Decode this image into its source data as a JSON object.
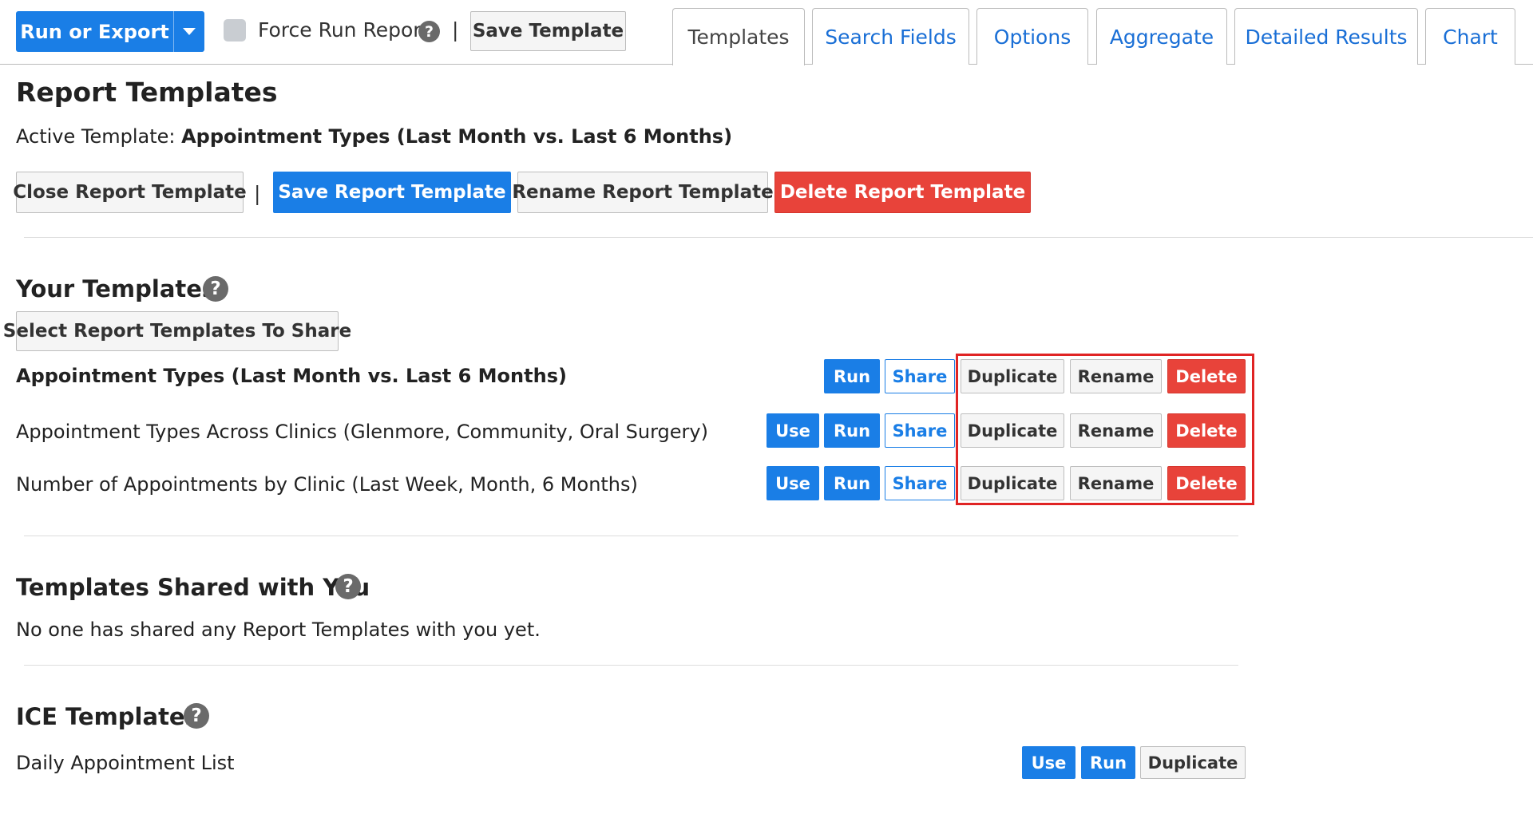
{
  "toolbar": {
    "run_or_export": "Run or Export",
    "force_run_label": "Force Run Report",
    "separator": "|",
    "save_template": "Save Template"
  },
  "tabs": [
    {
      "label": "Templates",
      "active": true
    },
    {
      "label": "Search Fields"
    },
    {
      "label": "Options"
    },
    {
      "label": "Aggregate"
    },
    {
      "label": "Detailed Results"
    },
    {
      "label": "Chart"
    }
  ],
  "page": {
    "title": "Report Templates",
    "active_prefix": "Active Template: ",
    "active_name": "Appointment Types (Last Month vs. Last 6 Months)"
  },
  "active_actions": {
    "close": "Close Report Template",
    "separator": "|",
    "save": "Save Report Template",
    "rename": "Rename Report Template",
    "delete": "Delete Report Template"
  },
  "your_templates": {
    "heading": "Your Templates",
    "share_select": "Select Report Templates To Share",
    "rows": [
      {
        "name": "Appointment Types (Last Month vs. Last 6 Months)"
      },
      {
        "name": "Appointment Types Across Clinics (Glenmore, Community, Oral Surgery)"
      },
      {
        "name": "Number of Appointments by Clinic (Last Week, Month, 6 Months)"
      }
    ],
    "labels": {
      "use": "Use",
      "run": "Run",
      "share": "Share",
      "duplicate": "Duplicate",
      "rename": "Rename",
      "delete": "Delete"
    }
  },
  "shared": {
    "heading": "Templates Shared with You",
    "empty": "No one has shared any Report Templates with you yet."
  },
  "ice": {
    "heading": "ICE Templates",
    "rows": [
      {
        "name": "Daily Appointment List"
      }
    ],
    "labels": {
      "use": "Use",
      "run": "Run",
      "duplicate": "Duplicate"
    }
  },
  "help_glyph": "?",
  "colors": {
    "primary": "#1a7ee6",
    "danger": "#e8433a",
    "highlight": "#e02424"
  }
}
